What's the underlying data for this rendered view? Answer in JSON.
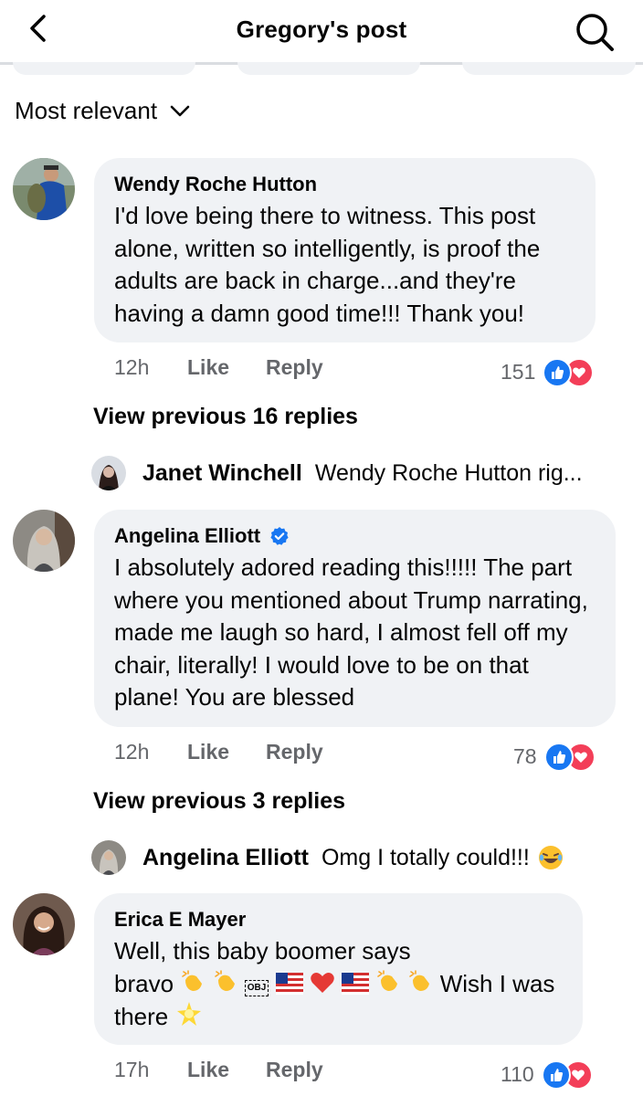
{
  "header": {
    "title": "Gregory's post",
    "back_icon": "chevron-left-icon",
    "search_icon": "search-icon"
  },
  "sort": {
    "label": "Most relevant",
    "icon": "chevron-down-icon"
  },
  "comments": [
    {
      "author": "Wendy Roche Hutton",
      "text": "I'd love being there to witness. This post alone, written so intelligently,  is proof the adults are back in charge...and they're having a damn good time!!! Thank you!",
      "time": "12h",
      "like_label": "Like",
      "reply_label": "Reply",
      "reactions": "151",
      "view_previous": "View previous 16 replies",
      "reply": {
        "author": "Janet Winchell",
        "text": "Wendy Roche Hutton rig..."
      }
    },
    {
      "author": "Angelina Elliott",
      "verified": true,
      "text": "I absolutely adored reading this!!!!! The part where you mentioned about Trump narrating, made me laugh so hard, I almost fell off my chair, literally! I would love to be on that plane! You are blessed",
      "time": "12h",
      "like_label": "Like",
      "reply_label": "Reply",
      "reactions": "78",
      "view_previous": "View previous 3 replies",
      "reply": {
        "author": "Angelina Elliott",
        "text": "Omg I totally could!!!"
      }
    },
    {
      "author": "Erica E Mayer",
      "text_line1": "Well, this baby boomer says",
      "text_line2_start": "bravo",
      "text_line2_end": " Wish I was",
      "text_line3": "there",
      "obj_label": "OBJ",
      "time": "17h",
      "like_label": "Like",
      "reply_label": "Reply",
      "reactions": "110"
    }
  ],
  "colors": {
    "like_blue": "#1877f2",
    "love_red": "#f33e58",
    "bubble_bg": "#f0f2f5",
    "meta_gray": "#65676b",
    "verified_blue": "#1877f2"
  }
}
